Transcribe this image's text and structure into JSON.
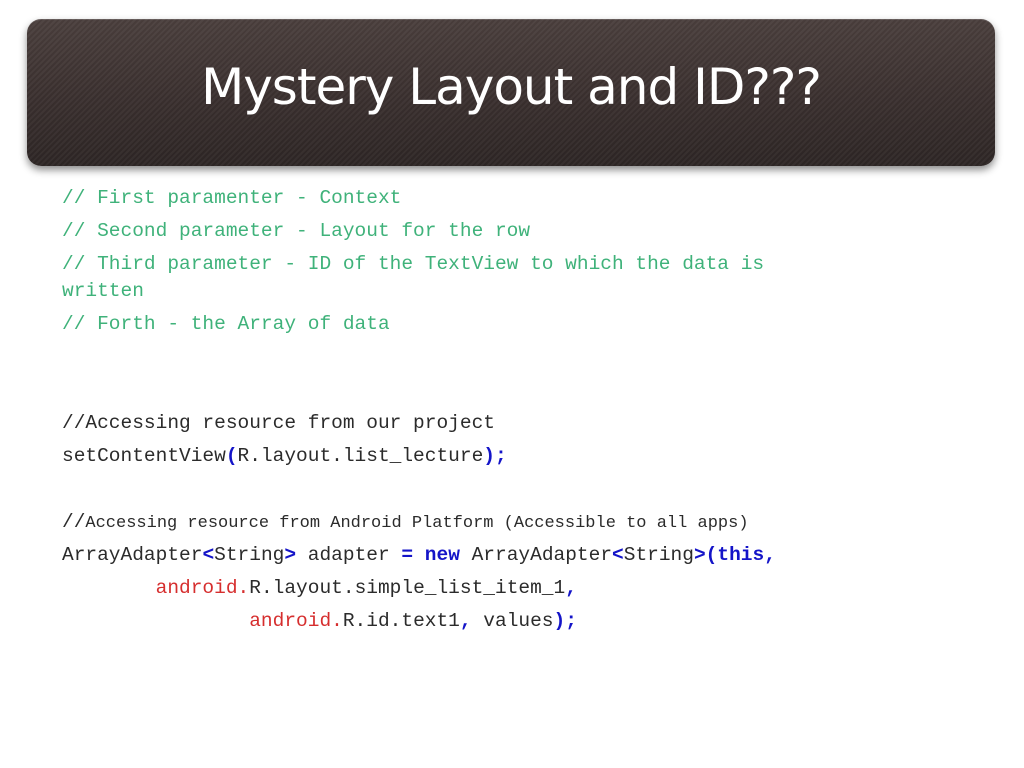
{
  "slide": {
    "title": "Mystery Layout and ID???"
  },
  "comments": [
    "// First paramenter - Context",
    "// Second parameter - Layout for the row",
    "// Third parameter - ID of the TextView to which the data is",
    "written",
    "// Forth - the Array of data"
  ],
  "code": {
    "comment_project": "//Accessing resource from our project",
    "set_content_view": {
      "method": "setContentView",
      "open_paren": "(",
      "arg": "R.layout.list_lecture",
      "close": ");"
    },
    "comment_platform_prefix": "//",
    "comment_platform_text": "Accessing resource from Android Platform (Accessible to all apps)",
    "adapter_line": {
      "type1": "ArrayAdapter",
      "lt1": "<",
      "generic1": "String",
      "gt1": ">",
      "var": " adapter ",
      "eq": "=",
      "space1": " ",
      "new_kw": "new",
      "space2": " ",
      "type2": "ArrayAdapter",
      "lt2": "<",
      "generic2": "String",
      "gt2": ">",
      "open": "(",
      "this_kw": "this",
      "comma": ","
    },
    "layout_line": {
      "indent": "        ",
      "pkg": "android.",
      "ref": "R.layout.simple_list_item_1",
      "comma": ","
    },
    "id_line": {
      "indent": "                ",
      "pkg": "android.",
      "ref": "R.id.text1",
      "comma": ",",
      "values": " values",
      "close": ");"
    }
  },
  "colors": {
    "title_bar": "#3a302f",
    "comment": "#3fb27a",
    "keyword": "#1414c8",
    "package": "#d62e2e"
  }
}
